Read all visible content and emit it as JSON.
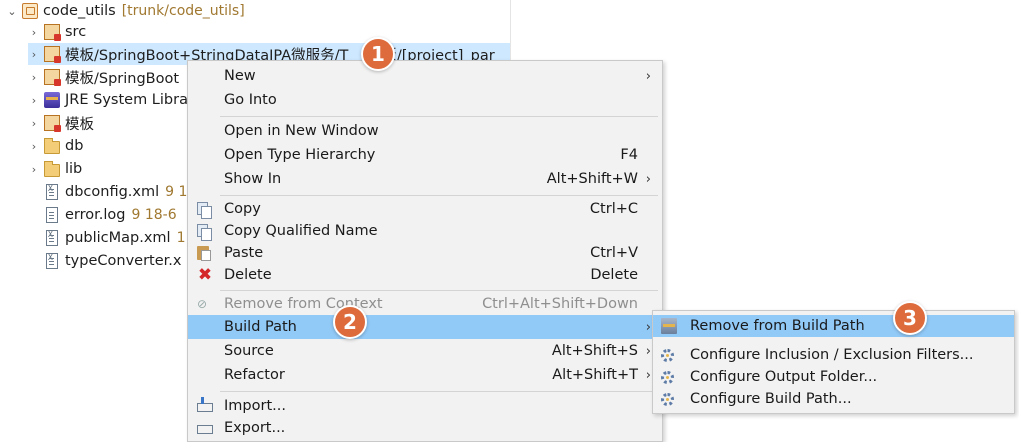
{
  "tree": {
    "root": {
      "label": "code_utils",
      "decoration": "[trunk/code_utils]",
      "expanded": true
    },
    "items": [
      {
        "label": "src",
        "icon": "source-package-icon",
        "decoration": ""
      },
      {
        "label": "模板/SpringBoot+StringDataJPA微服务/T",
        "tail": "板/[project]_par",
        "icon": "source-package-icon",
        "selected": true
      },
      {
        "label": "模板/SpringBoot",
        "icon": "source-package-icon"
      },
      {
        "label": "JRE System Libra",
        "icon": "jre-library-icon"
      },
      {
        "label": "模板",
        "icon": "source-package-icon"
      },
      {
        "label": "db",
        "icon": "folder-icon"
      },
      {
        "label": "lib",
        "icon": "folder-icon"
      },
      {
        "label": "dbconfig.xml",
        "decoration": "9  1",
        "icon": "xml-file-icon"
      },
      {
        "label": "error.log",
        "decoration": "9  18-6",
        "icon": "log-file-icon"
      },
      {
        "label": "publicMap.xml",
        "decoration": "1",
        "icon": "xml-file-icon"
      },
      {
        "label": "typeConverter.x",
        "decoration": "",
        "icon": "xml-file-icon"
      }
    ]
  },
  "menu": {
    "new": {
      "label": "New"
    },
    "go_into": {
      "label": "Go Into"
    },
    "open_new_window": {
      "label": "Open in New Window"
    },
    "open_type_hierarchy": {
      "label": "Open Type Hierarchy",
      "shortcut": "F4"
    },
    "show_in": {
      "label": "Show In",
      "shortcut": "Alt+Shift+W"
    },
    "copy": {
      "label": "Copy",
      "shortcut": "Ctrl+C"
    },
    "copy_qualified": {
      "label": "Copy Qualified Name"
    },
    "paste": {
      "label": "Paste",
      "shortcut": "Ctrl+V"
    },
    "delete": {
      "label": "Delete",
      "shortcut": "Delete"
    },
    "remove_context": {
      "label": "Remove from Context",
      "shortcut": "Ctrl+Alt+Shift+Down",
      "disabled": true
    },
    "build_path": {
      "label": "Build Path",
      "highlighted": true
    },
    "source": {
      "label": "Source",
      "shortcut": "Alt+Shift+S"
    },
    "refactor": {
      "label": "Refactor",
      "shortcut": "Alt+Shift+T"
    },
    "import": {
      "label": "Import..."
    },
    "export": {
      "label": "Export..."
    }
  },
  "submenu": {
    "remove_build_path": {
      "label": "Remove from Build Path",
      "highlighted": true
    },
    "configure_filters": {
      "label": "Configure Inclusion / Exclusion Filters..."
    },
    "configure_output": {
      "label": "Configure Output Folder..."
    },
    "configure_build_path": {
      "label": "Configure Build Path..."
    }
  },
  "arrow_glyph": "›",
  "badges": {
    "one": "1",
    "two": "2",
    "three": "3"
  },
  "colors": {
    "highlight": "#91c9f7",
    "selection": "#cde8ff",
    "badge": "#dd6b3c"
  }
}
